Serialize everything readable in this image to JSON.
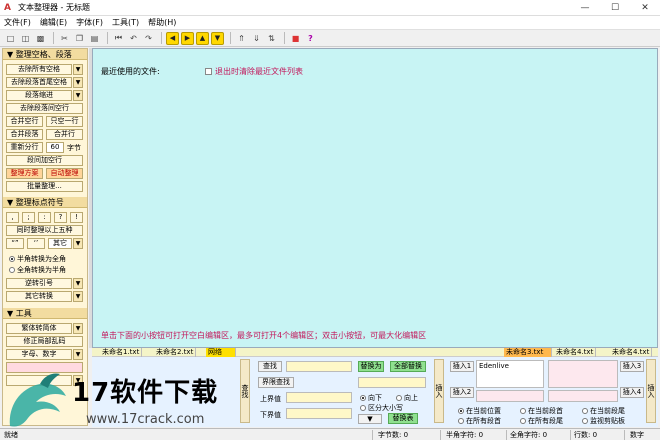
{
  "window": {
    "title": "文本整理器 - 无标题",
    "controls": [
      "minimize-icon",
      "maximize-icon",
      "close-icon"
    ]
  },
  "menu": [
    "文件(F)",
    "编辑(E)",
    "字体(F)",
    "工具(T)",
    "帮助(H)"
  ],
  "toolbar_icons": [
    "new-icon",
    "open-icon",
    "save-icon",
    "cut-icon",
    "copy-icon",
    "paste-icon",
    "begin-icon",
    "undo-icon",
    "redo-icon",
    "left-icon",
    "right-icon",
    "up-icon",
    "down-icon",
    "pin-icon",
    "pin-icon",
    "exchange-icon",
    "color-icon",
    "help-icon"
  ],
  "left": {
    "sec1": "整理空格、段落",
    "b_del_spaces": "去除所有空格",
    "b_del_para_spaces": "去除段落首尾空格",
    "b_indent": "段落缩进",
    "b_del_para_blank": "去除段落间空行",
    "b_merge_blank": "合并空行",
    "b_keep_one": "只空一行",
    "b_merge_para": "合并段落",
    "b_merge_line": "合并行",
    "b_rewrap": "重新分行",
    "rewrap_value": "60",
    "rewrap_unit": "字节",
    "b_add_blank": "段间加空行",
    "b_plan": "整理方案",
    "b_auto": "自动整理",
    "b_batch": "批量整理...",
    "sec2": "整理标点符号",
    "p1": ",",
    "p2": ";",
    "p3": ":",
    "p4": "?",
    "p5": "!",
    "b_sync": "同时整理以上五种",
    "p6": "“”",
    "p7": "‘’",
    "p8": "其它",
    "r_half_full": "半角转换为全角",
    "r_full_half": "全角转换为半角",
    "b_reverse_quote": "逆转引号",
    "b_other": "其它转换",
    "sec3": "工具",
    "b_trad": "繁体转简体",
    "b_fix_garble": "修正局部乱码",
    "b_char_digit": "字母、数字"
  },
  "editor": {
    "recent_label": "最近使用的文件:",
    "recent_check": "退出时清除最近文件列表",
    "hint": "单击下面的小按钮可打开空白编辑区，最多可打开4个编辑区；双击小按钮，可最大化编辑区"
  },
  "tabs": [
    "未命名1.txt",
    "未命名2.txt",
    "网络",
    "未命名3.txt",
    "未命名4.txt",
    "未命名4.txt"
  ],
  "bottom": {
    "vtab_find": "查找",
    "vtab_insert": "插入",
    "b_find": "查找",
    "b_bound_find": "界限查找",
    "lbl_upper": "上界值",
    "lbl_lower": "下界值",
    "b_replace": "替换为",
    "b_replace_all": "全部替换",
    "r_down": "向下",
    "r_up": "向上",
    "chk_case": "区分大小写",
    "b_replace_table": "替换表",
    "b_insert1": "插入1",
    "b_insert2": "插入2",
    "b_insert3": "插入3",
    "b_insert4": "插入4",
    "insert1_value": "Edenlive",
    "r_cur_pos": "在当前位置",
    "r_cur_para_head": "在当前段首",
    "r_cur_para_tail": "在当前段尾",
    "r_all_head": "在所有段首",
    "r_all_tail": "在所有段尾",
    "chk_monitor": "监视剪贴板"
  },
  "status": {
    "ready": "就绪",
    "bytes": "字节数: 0",
    "half": "半角字符: 0",
    "full": "全角字符: 0",
    "lines": "行数: 0",
    "mode": "数字"
  },
  "watermark": {
    "text": "17软件下载",
    "url": "www.17crack.com"
  }
}
